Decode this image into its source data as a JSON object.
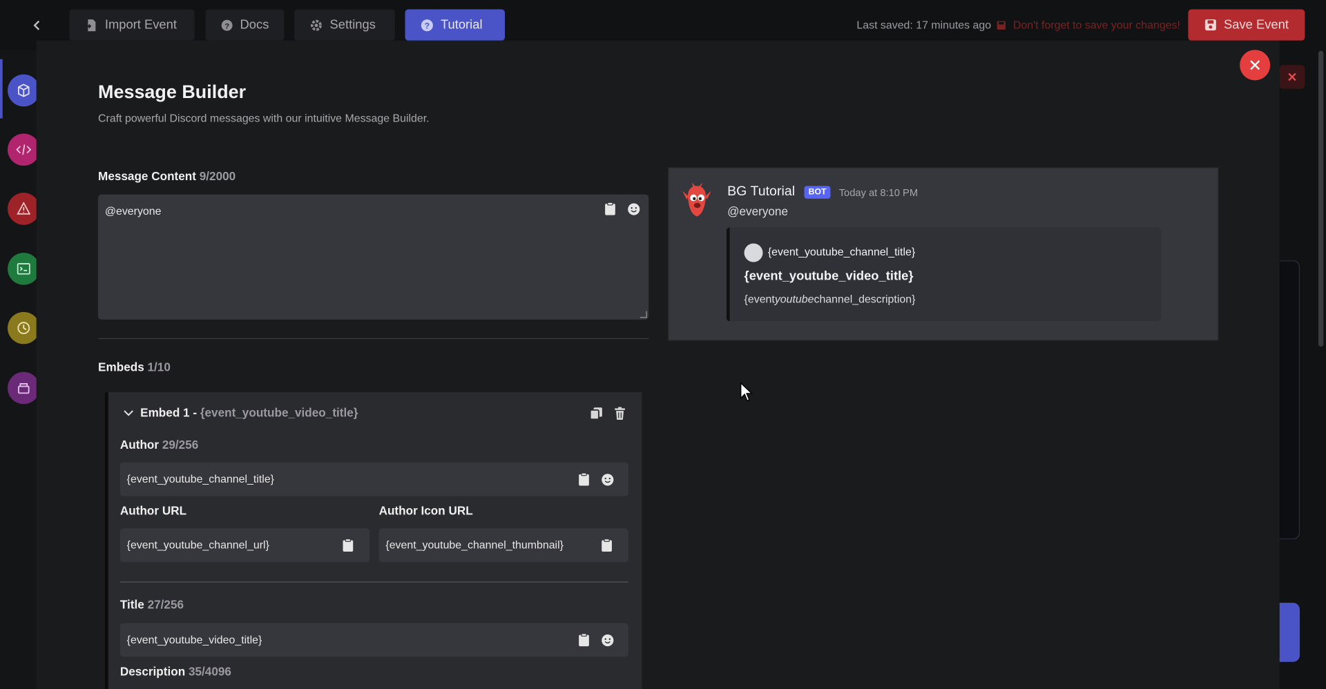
{
  "topbar": {
    "tabs": [
      {
        "label": "Import Event",
        "icon": "file-import-icon"
      },
      {
        "label": "Docs",
        "icon": "question-circle-icon"
      },
      {
        "label": "Settings",
        "icon": "gear-icon"
      },
      {
        "label": "Tutorial",
        "icon": "question-circle-icon",
        "active": true
      }
    ],
    "last_saved": "Last saved: 17 minutes ago",
    "warning": "Don't forget to save your changes!",
    "save_label": "Save Event"
  },
  "rail": {
    "items": [
      {
        "icon": "cube-icon",
        "color": "#4a54c6"
      },
      {
        "icon": "code-icon",
        "color": "#b0256e"
      },
      {
        "icon": "warning-icon",
        "color": "#9e2329"
      },
      {
        "icon": "terminal-icon",
        "color": "#1f7a3e"
      },
      {
        "icon": "clock-icon",
        "color": "#8a7a1d"
      },
      {
        "icon": "database-icon",
        "color": "#6a2a78"
      }
    ]
  },
  "modal": {
    "title": "Message Builder",
    "subtitle": "Craft powerful Discord messages with our intuitive Message Builder.",
    "content": {
      "label": "Message Content",
      "count": "9/2000",
      "value": "@everyone"
    },
    "embeds": {
      "label": "Embeds",
      "count": "1/10",
      "embed": {
        "heading_prefix": "Embed 1 - ",
        "heading_title": "{event_youtube_video_title}",
        "author": {
          "label": "Author",
          "count": "29/256",
          "value": "{event_youtube_channel_title}"
        },
        "author_url": {
          "label": "Author URL",
          "value": "{event_youtube_channel_url}"
        },
        "author_icon_url": {
          "label": "Author Icon URL",
          "value": "{event_youtube_channel_thumbnail}"
        },
        "title": {
          "label": "Title",
          "count": "27/256",
          "value": "{event_youtube_video_title}"
        },
        "description": {
          "label": "Description",
          "count": "35/4096"
        }
      }
    }
  },
  "preview": {
    "bot_name": "BG Tutorial",
    "bot_tag": "BOT",
    "timestamp": "Today at 8:10 PM",
    "mention": "@everyone",
    "embed": {
      "author": "{event_youtube_channel_title}",
      "title": "{event_youtube_video_title}",
      "desc_a": "{event",
      "desc_b": "youtube",
      "desc_c": "channel_description}"
    }
  },
  "colors": {
    "accent": "#4a54c6",
    "danger": "#e53e3e",
    "save": "#b32a2f"
  }
}
